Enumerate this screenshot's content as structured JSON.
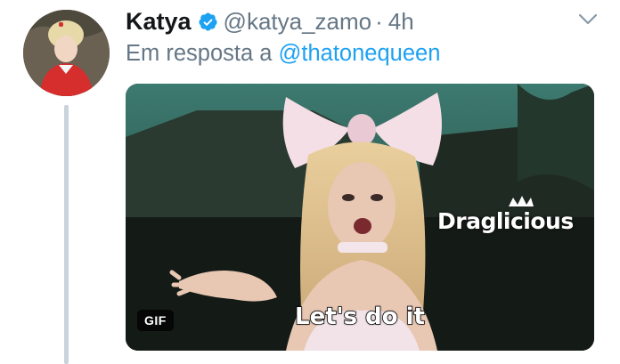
{
  "tweet": {
    "author_name": "Katya",
    "author_handle": "@katya_zamo",
    "separator": "·",
    "time": "4h",
    "reply_prefix": "Em resposta a",
    "reply_to": "@thatonequeen"
  },
  "media": {
    "badge": "GIF",
    "caption": "Let's do it",
    "brand": "Draglicious"
  },
  "icons": {
    "verified": "verified-badge-icon",
    "more": "chevron-down-icon"
  },
  "colors": {
    "name": "#14171a",
    "meta": "#657786",
    "link": "#1da1f2",
    "verified": "#1da1f2",
    "thread_line": "#c9d3db"
  }
}
